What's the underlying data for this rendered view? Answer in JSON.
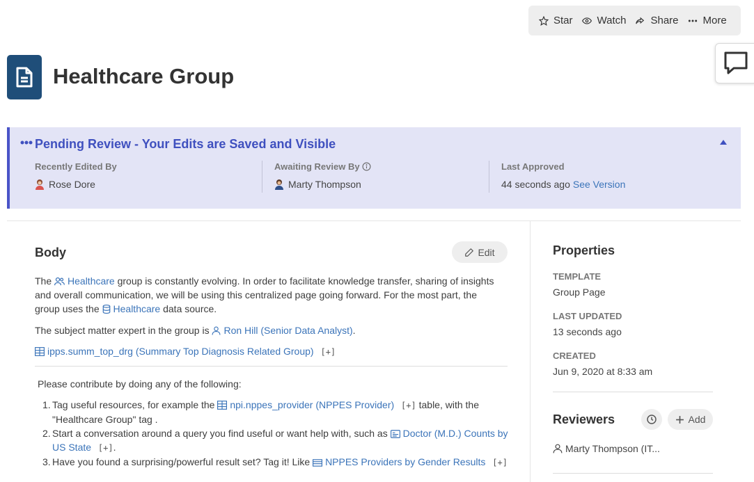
{
  "toolbar": {
    "star": "Star",
    "watch": "Watch",
    "share": "Share",
    "more": "More"
  },
  "page": {
    "title": "Healthcare Group"
  },
  "banner": {
    "title": "Pending Review - Your Edits are Saved and Visible",
    "recently_edited_label": "Recently Edited By",
    "recently_edited_value": "Rose Dore",
    "awaiting_label": "Awaiting Review By",
    "awaiting_value": "Marty Thompson",
    "approved_label": "Last Approved",
    "approved_value": "44 seconds ago",
    "see_version": "See Version",
    "accent_color": "#4a54c8"
  },
  "body": {
    "heading": "Body",
    "edit_label": "Edit",
    "p1_a": "The",
    "p1_link1": "Healthcare",
    "p1_b": "group is constantly evolving. In order to facilitate knowledge transfer, sharing of insights and overall communication, we will be using this centralized page going forward. For the most part, the group uses the",
    "p1_link2": "Healthcare",
    "p1_c": "data source.",
    "p2_a": "The subject matter expert in the group is",
    "p2_link": "Ron Hill (Senior Data Analyst)",
    "p2_b": ".",
    "p3_link": "ipps.summ_top_drg (Summary Top Diagnosis Related Group)",
    "bracket": "[+]",
    "contribute": "Please contribute by doing any of the following:",
    "steps": [
      {
        "num": "1.",
        "a": "Tag useful resources, for example the",
        "link": "npi.nppes_provider (NPPES Provider)",
        "b": "table, with the \"Healthcare Group\" tag ."
      },
      {
        "num": "2.",
        "a": "Start a conversation around a query you find useful or want help with, such as",
        "link": "Doctor (M.D.) Counts by US State",
        "b": "."
      },
      {
        "num": "3.",
        "a": "Have you found a surprising/powerful result set? Tag it! Like",
        "link": "NPPES Providers by Gender Results",
        "b": ""
      }
    ]
  },
  "properties": {
    "heading": "Properties",
    "template_label": "TEMPLATE",
    "template_value": "Group Page",
    "updated_label": "LAST UPDATED",
    "updated_value": "13 seconds ago",
    "created_label": "CREATED",
    "created_value": "Jun 9, 2020 at 8:33 am"
  },
  "reviewers": {
    "heading": "Reviewers",
    "add_label": "Add",
    "items": [
      {
        "name": "Marty Thompson (IT..."
      }
    ]
  },
  "icons": {
    "star": "star-icon",
    "watch": "eye-icon",
    "share": "share-icon",
    "more": "ellipsis-icon",
    "chat": "chat-icon",
    "doc": "document-icon",
    "group": "group-icon",
    "database": "database-icon",
    "user": "user-icon",
    "table": "table-icon",
    "query": "query-icon",
    "result": "result-icon",
    "clock": "clock-icon",
    "plus": "plus-icon",
    "pencil": "pencil-icon",
    "info": "info-icon",
    "caret": "caret-up-icon"
  }
}
